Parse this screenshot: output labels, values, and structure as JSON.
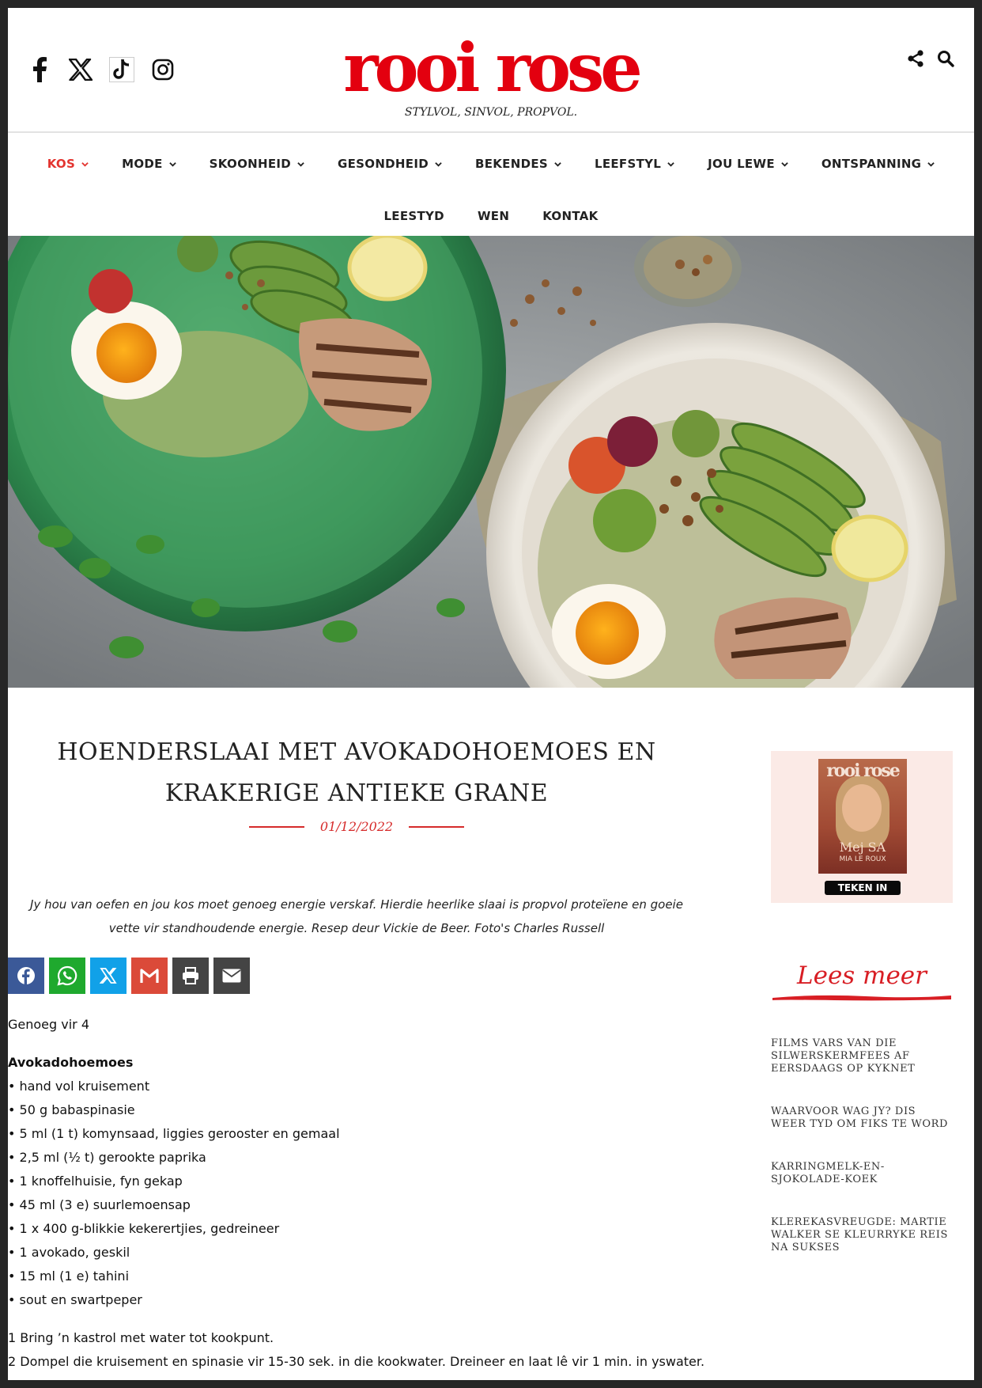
{
  "brand": {
    "logo": "rooi rose",
    "tagline": "STYLVOL, SINVOL, PROPVOL.",
    "logo_color": "#e3000f"
  },
  "social_icons": [
    "facebook-icon",
    "x-icon",
    "tiktok-icon",
    "instagram-icon"
  ],
  "header_tools": [
    "share-icon",
    "search-icon"
  ],
  "nav": {
    "row1": [
      {
        "label": "KOS",
        "active": true,
        "dropdown": true
      },
      {
        "label": "MODE",
        "dropdown": true
      },
      {
        "label": "SKOONHEID",
        "dropdown": true
      },
      {
        "label": "GESONDHEID",
        "dropdown": true
      },
      {
        "label": "BEKENDES",
        "dropdown": true
      },
      {
        "label": "LEEFSTYL",
        "dropdown": true
      },
      {
        "label": "JOU LEWE",
        "dropdown": true
      },
      {
        "label": "ONTSPANNING",
        "dropdown": true
      }
    ],
    "row2": [
      {
        "label": "LEESTYD"
      },
      {
        "label": "WEN"
      },
      {
        "label": "KONTAK"
      }
    ]
  },
  "article": {
    "title": "HOENDERSLAAI MET AVOKADOHOEMOES EN KRAKERIGE ANTIEKE GRANE",
    "date": "01/12/2022",
    "intro": "Jy hou van oefen en jou kos moet genoeg energie verskaf. Hierdie heerlike slaai is propvol proteïene en goeie vette vir standhoudende energie. Resep deur Vickie de Beer. Foto's Charles Russell",
    "share_buttons": [
      {
        "icon": "facebook-icon",
        "color": "#3b5998"
      },
      {
        "icon": "whatsapp-icon",
        "color": "#1fa92e"
      },
      {
        "icon": "x-icon",
        "color": "#11a1e8"
      },
      {
        "icon": "gmail-icon",
        "color": "#db4a39"
      },
      {
        "icon": "print-icon",
        "color": "#444444"
      },
      {
        "icon": "email-icon",
        "color": "#444444"
      }
    ],
    "serves": "Genoeg vir 4",
    "section_heading": "Avokadohoemoes",
    "ingredients": [
      "• hand vol kruisement",
      "• 50 g babaspinasie",
      "• 5 ml (1 t) komynsaad, liggies gerooster en gemaal",
      "• 2,5 ml (½ t) gerookte paprika",
      "• 1 knoffelhuisie, fyn gekap",
      "• 45 ml (3 e) suurlemoensap",
      "• 1 x 400 g-blikkie kekerertjies, gedreineer",
      "• 1 avokado, geskil",
      "• 15 ml (1 e) tahini",
      "• sout en swartpeper"
    ],
    "steps": [
      "1 Bring ’n kastrol met water tot kookpunt.",
      "2 Dompel die kruisement en spinasie vir 15-30 sek. in die kookwater. Dreineer en laat lê vir 1 min. in yswater."
    ]
  },
  "sidebar": {
    "cover_masthead": "rooi rose",
    "cover_name": "Mej SA",
    "cover_sub": "MIA LE ROUX",
    "subscribe_label": "TEKEN IN",
    "lees_meer": "Lees meer",
    "related": [
      "FILMS VARS VAN DIE SILWERSKERMFEES AF EERSDAAGS OP KYKNET",
      "WAARVOOR WAG JY? DIS WEER TYD OM FIKS TE WORD",
      "KARRINGMELK-EN-SJOKOLADE-KOEK",
      "KLEREKASVREUGDE: MARTIE WALKER SE KLEURRYKE REIS NA SUKSES"
    ]
  }
}
